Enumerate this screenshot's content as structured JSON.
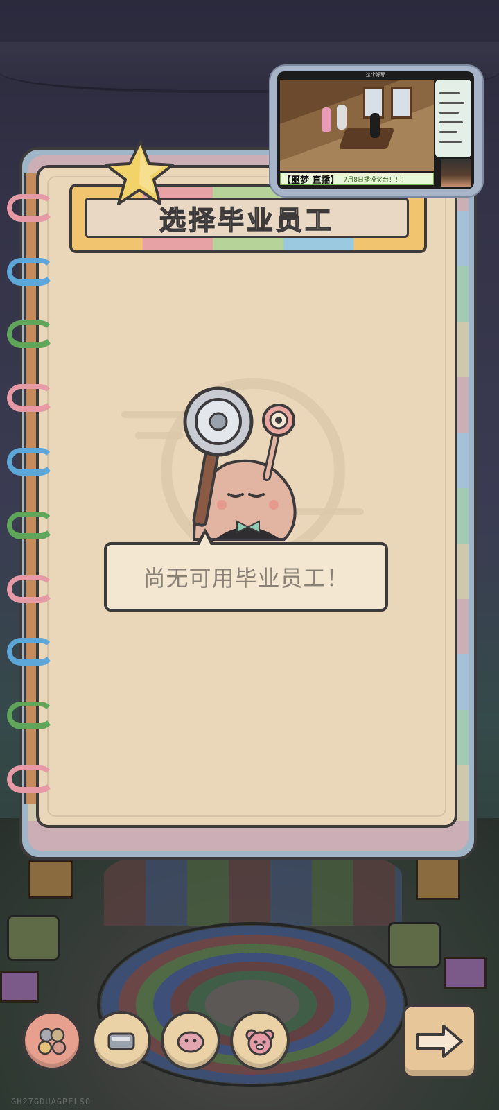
{
  "title": "选择毕业员工",
  "empty_message": "尚无可用毕业员工！",
  "video_overlay": {
    "top_label": "这个好耶",
    "caption_main": "【噩梦 直播】",
    "caption_sub": "7月8日播没奖台！！！"
  },
  "bottom_tabs": [
    {
      "icon": "animal-group-icon",
      "active": true
    },
    {
      "icon": "tray-icon",
      "active": false
    },
    {
      "icon": "pink-blob-icon",
      "active": false
    },
    {
      "icon": "bear-icon",
      "active": false
    }
  ],
  "next_button_icon": "right-arrow-icon",
  "user_id": "GH27GDUAGPELSO",
  "colors": {
    "page": "#ead6b9",
    "outline": "#3d3a3b",
    "title_text": "#cdbba6",
    "message_text": "#8a8176",
    "star": "#f1d36a"
  }
}
